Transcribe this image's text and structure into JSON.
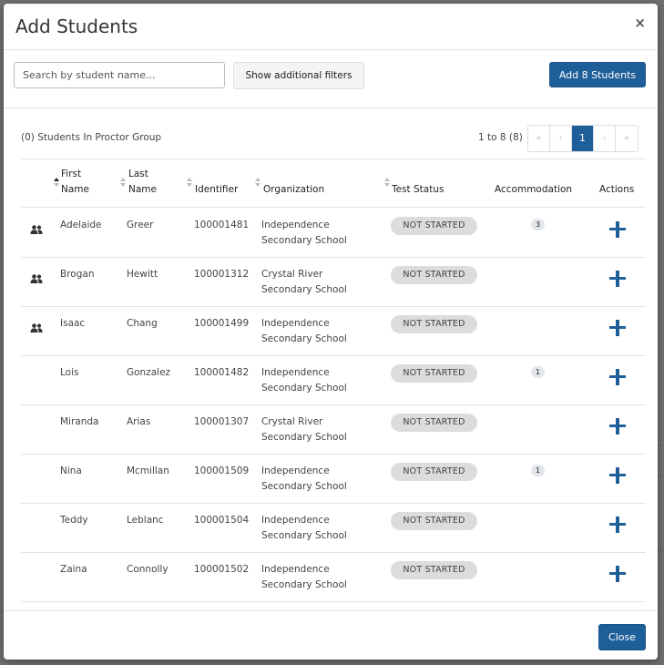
{
  "modal": {
    "title": "Add Students",
    "close_symbol": "×"
  },
  "toolbar": {
    "search_placeholder": "Search by student name...",
    "search_value": "",
    "filters_label": "Show additional filters",
    "add_label": "Add 8 Students"
  },
  "table_info": {
    "group_count": "(0) Students In Proctor Group",
    "range": "1 to 8 (8)"
  },
  "pagination": {
    "first": "«",
    "prev": "‹",
    "current": "1",
    "next": "›",
    "last": "»"
  },
  "headers": {
    "first_name_1": "First",
    "first_name_2": "Name",
    "last_name_1": "Last",
    "last_name_2": "Name",
    "identifier": "Identifier",
    "organization": "Organization",
    "test_status": "Test Status",
    "accommodation": "Accommodation",
    "actions": "Actions"
  },
  "rows": [
    {
      "group": true,
      "first": "Adelaide",
      "last": "Greer",
      "id": "100001481",
      "org1": "Independence",
      "org2": "Secondary School",
      "status": "NOT STARTED",
      "acc": "3"
    },
    {
      "group": true,
      "first": "Brogan",
      "last": "Hewitt",
      "id": "100001312",
      "org1": "Crystal River",
      "org2": "Secondary School",
      "status": "NOT STARTED",
      "acc": ""
    },
    {
      "group": true,
      "first": "Isaac",
      "last": "Chang",
      "id": "100001499",
      "org1": "Independence",
      "org2": "Secondary School",
      "status": "NOT STARTED",
      "acc": ""
    },
    {
      "group": false,
      "first": "Lois",
      "last": "Gonzalez",
      "id": "100001482",
      "org1": "Independence",
      "org2": "Secondary School",
      "status": "NOT STARTED",
      "acc": "1"
    },
    {
      "group": false,
      "first": "Miranda",
      "last": "Arias",
      "id": "100001307",
      "org1": "Crystal River",
      "org2": "Secondary School",
      "status": "NOT STARTED",
      "acc": ""
    },
    {
      "group": false,
      "first": "Nina",
      "last": "Mcmillan",
      "id": "100001509",
      "org1": "Independence",
      "org2": "Secondary School",
      "status": "NOT STARTED",
      "acc": "1"
    },
    {
      "group": false,
      "first": "Teddy",
      "last": "Leblanc",
      "id": "100001504",
      "org1": "Independence",
      "org2": "Secondary School",
      "status": "NOT STARTED",
      "acc": ""
    },
    {
      "group": false,
      "first": "Zaina",
      "last": "Connolly",
      "id": "100001502",
      "org1": "Independence",
      "org2": "Secondary School",
      "status": "NOT STARTED",
      "acc": ""
    }
  ],
  "footer": {
    "close_label": "Close"
  },
  "colors": {
    "primary": "#1f5f99",
    "badge_gray": "#dcdcdc",
    "backdrop": "#6f6f6f"
  }
}
